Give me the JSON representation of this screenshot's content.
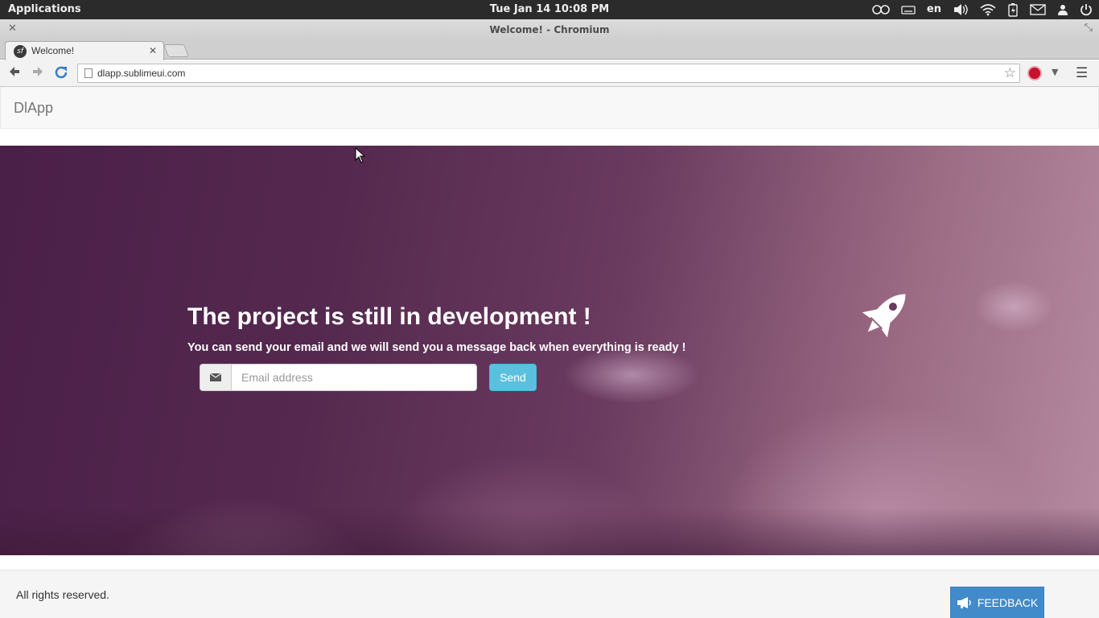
{
  "system_bar": {
    "applications_label": "Applications",
    "clock": "Tue Jan 14 10:08 PM",
    "keyboard_layout": "en",
    "icons": [
      "accessibility-icon",
      "keyboard-icon",
      "volume-icon",
      "wifi-icon",
      "battery-icon",
      "mail-icon",
      "user-icon",
      "power-icon"
    ]
  },
  "window": {
    "title": "Welcome! - Chromium"
  },
  "browser": {
    "tab_title": "Welcome!",
    "tab_favicon": "sf",
    "url": "dlapp.sublimeui.com"
  },
  "page": {
    "brand": "DlApp",
    "hero": {
      "title": "The project is still in development !",
      "subtitle": "You can send your email and we will send you a message back when everything is ready !",
      "email_placeholder": "Email address",
      "send_label": "Send"
    },
    "footer": {
      "copyright": "All rights reserved.",
      "feedback_label": "FEEDBACK"
    }
  },
  "colors": {
    "send_button": "#5bc0de",
    "feedback_button": "#428bca",
    "hero_base": "#4a1f48"
  }
}
